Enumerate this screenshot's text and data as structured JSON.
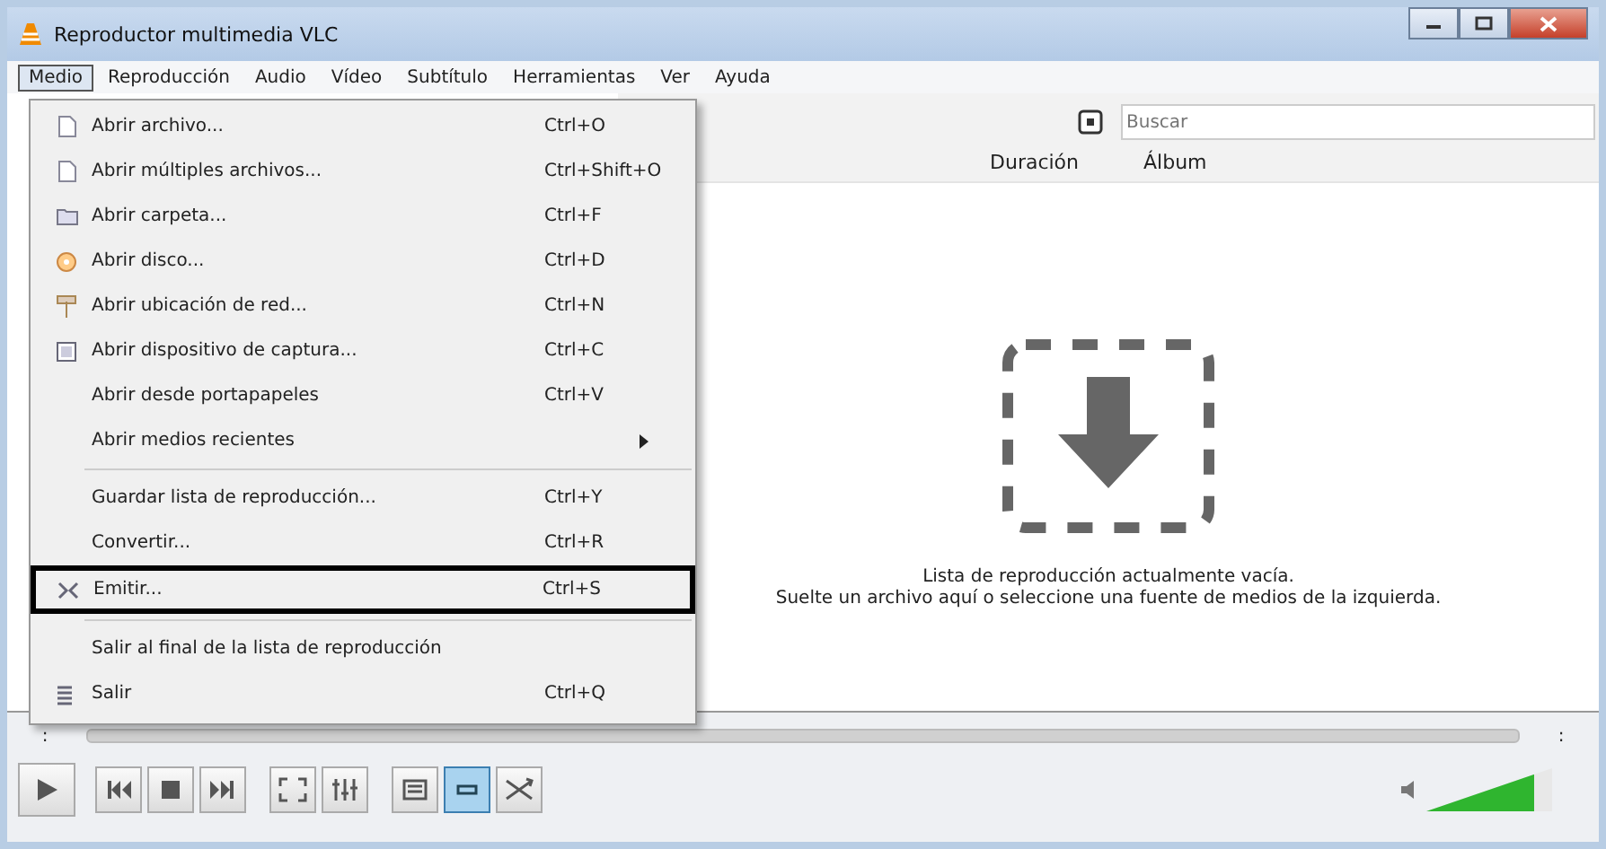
{
  "window": {
    "title": "Reproductor multimedia VLC"
  },
  "menu_bar": [
    {
      "label": "Medio",
      "selected": true
    },
    {
      "label": "Reproducción",
      "selected": false
    },
    {
      "label": "Audio",
      "selected": false
    },
    {
      "label": "Vídeo",
      "selected": false
    },
    {
      "label": "Subtítulo",
      "selected": false
    },
    {
      "label": "Herramientas",
      "selected": false
    },
    {
      "label": "Ver",
      "selected": false
    },
    {
      "label": "Ayuda",
      "selected": false
    }
  ],
  "dropdown": [
    {
      "kind": "item",
      "label": "Abrir archivo...",
      "shortcut": "Ctrl+O",
      "highlighted": false
    },
    {
      "kind": "item",
      "label": "Abrir múltiples archivos...",
      "shortcut": "Ctrl+Shift+O",
      "highlighted": false
    },
    {
      "kind": "item",
      "label": "Abrir carpeta...",
      "shortcut": "Ctrl+F",
      "highlighted": false
    },
    {
      "kind": "item",
      "label": "Abrir disco...",
      "shortcut": "Ctrl+D",
      "highlighted": false
    },
    {
      "kind": "item",
      "label": "Abrir ubicación de red...",
      "shortcut": "Ctrl+N",
      "highlighted": false
    },
    {
      "kind": "item",
      "label": "Abrir dispositivo de captura...",
      "shortcut": "Ctrl+C",
      "highlighted": false
    },
    {
      "kind": "item",
      "label": "Abrir desde portapapeles",
      "shortcut": "Ctrl+V",
      "highlighted": false
    },
    {
      "kind": "submenu",
      "label": "Abrir medios recientes",
      "highlighted": false
    },
    {
      "kind": "separator"
    },
    {
      "kind": "item",
      "label": "Guardar lista de reproducción...",
      "shortcut": "Ctrl+Y",
      "highlighted": false
    },
    {
      "kind": "item",
      "label": "Convertir...",
      "shortcut": "Ctrl+R",
      "highlighted": false
    },
    {
      "kind": "item",
      "label": "Emitir...",
      "shortcut": "Ctrl+S",
      "highlighted": true
    },
    {
      "kind": "separator"
    },
    {
      "kind": "item",
      "label": "Salir al final de la lista de reproducción",
      "highlighted": false
    },
    {
      "kind": "item",
      "label": "Salir",
      "shortcut": "Ctrl+Q",
      "highlighted": false
    }
  ],
  "search": {
    "placeholder": "Buscar"
  },
  "playlist": {
    "columns": [
      "Duración",
      "Álbum"
    ],
    "empty_lines": [
      "Lista de reproducción actualmente vacía.",
      "Suelte un archivo aquí o seleccione una fuente de medios de la izquierda."
    ]
  },
  "seek": {
    "elapsed": ":",
    "total": ":",
    "level": 0
  },
  "controls": [
    {
      "kind": "play",
      "selected": false
    },
    {
      "kind": "prev",
      "selected": false
    },
    {
      "kind": "stop",
      "selected": false
    },
    {
      "kind": "next",
      "selected": false
    },
    {
      "kind": "fullscreen",
      "selected": false
    },
    {
      "kind": "extended",
      "selected": false
    },
    {
      "kind": "playlist",
      "selected": false
    },
    {
      "kind": "loop",
      "selected": true
    },
    {
      "kind": "shuffle",
      "selected": false
    }
  ],
  "volume": {
    "level": 0.85
  }
}
